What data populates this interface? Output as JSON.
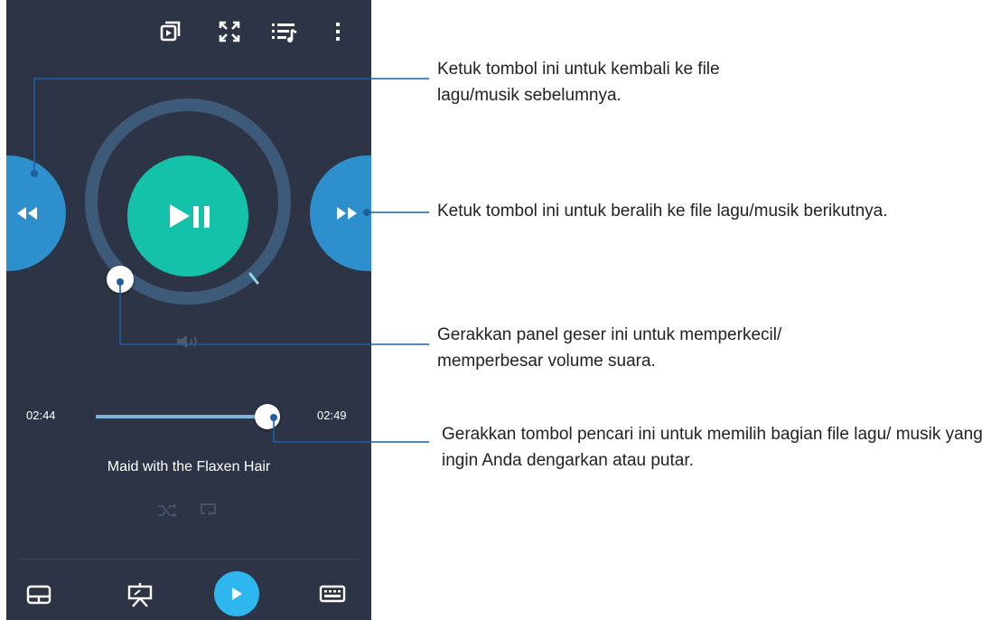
{
  "player": {
    "time_elapsed": "02:44",
    "time_total": "02:49",
    "progress_fraction": 0.93,
    "song_title": "Maid with the Flaxen Hair"
  },
  "annotations": {
    "previous": "Ketuk tombol ini untuk kembali ke file lagu/musik sebelumnya.",
    "next": "Ketuk tombol ini untuk beralih ke file lagu/musik berikutnya.",
    "volume": "Gerakkan panel geser ini untuk memperkecil/ memperbesar volume suara.",
    "seek": "Gerakkan tombol pencari ini untuk memilih bagian file lagu/ musik yang ingin Anda dengarkan atau putar."
  },
  "colors": {
    "panel_bg": "#2c3445",
    "accent_blue": "#2d8fcb",
    "play_teal": "#13c2a8",
    "bottom_play": "#2eb7ee"
  },
  "icons": [
    "cast-icon",
    "fullscreen-icon",
    "playlist-icon",
    "more-vertical-icon",
    "rewind-icon",
    "play-pause-icon",
    "fast-forward-icon",
    "volume-icon",
    "shuffle-icon",
    "repeat-icon",
    "touchpad-icon",
    "presentation-icon",
    "play-icon",
    "keyboard-icon"
  ]
}
